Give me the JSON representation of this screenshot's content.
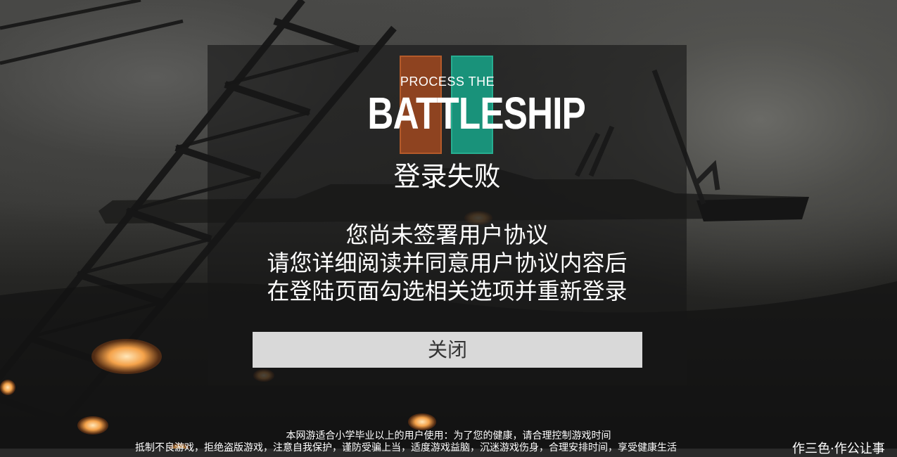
{
  "logo": {
    "top_text": "PROCESS THE",
    "main_text": "BATTLESHIP",
    "colors": {
      "orange": "#8e4320",
      "teal": "#19927a"
    }
  },
  "dialog": {
    "title": "登录失败",
    "message_lines": [
      "您尚未签署用户协议",
      "请您详细阅读并同意用户协议内容后",
      "在登陆页面勾选相关选项并重新登录"
    ],
    "close_label": "关闭"
  },
  "footer": {
    "line1": "本网游适合小学毕业以上的用户使用：为了您的健康，请合理控制游戏时间",
    "line2": "抵制不良游戏，拒绝盗版游戏，注意自我保护，谨防受骗上当，适度游戏益脑，沉迷游戏伤身，合理安排时间，享受健康生活",
    "right_text": "作三色·作公让事"
  }
}
